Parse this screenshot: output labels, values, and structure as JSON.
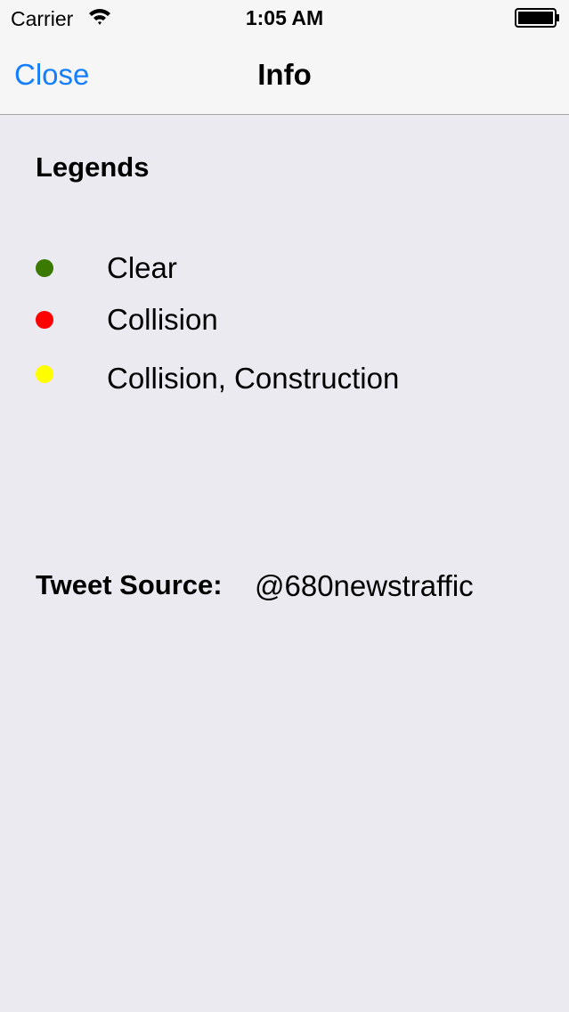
{
  "status_bar": {
    "carrier": "Carrier",
    "time": "1:05 AM",
    "wifi_icon": "wifi-icon",
    "battery_icon": "battery-full-icon"
  },
  "nav": {
    "close_label": "Close",
    "title": "Info"
  },
  "legends": {
    "heading": "Legends",
    "items": [
      {
        "label": "Clear",
        "color": "#3a7a00"
      },
      {
        "label": "Collision",
        "color": "#ff0000"
      },
      {
        "label": "Collision, Construction",
        "color": "#ffff00"
      }
    ]
  },
  "tweet_source": {
    "label": "Tweet Source:",
    "value": "@680newstraffic"
  },
  "colors": {
    "accent": "#157efb",
    "background": "#ebeaf1",
    "bar": "#f6f6f6"
  }
}
